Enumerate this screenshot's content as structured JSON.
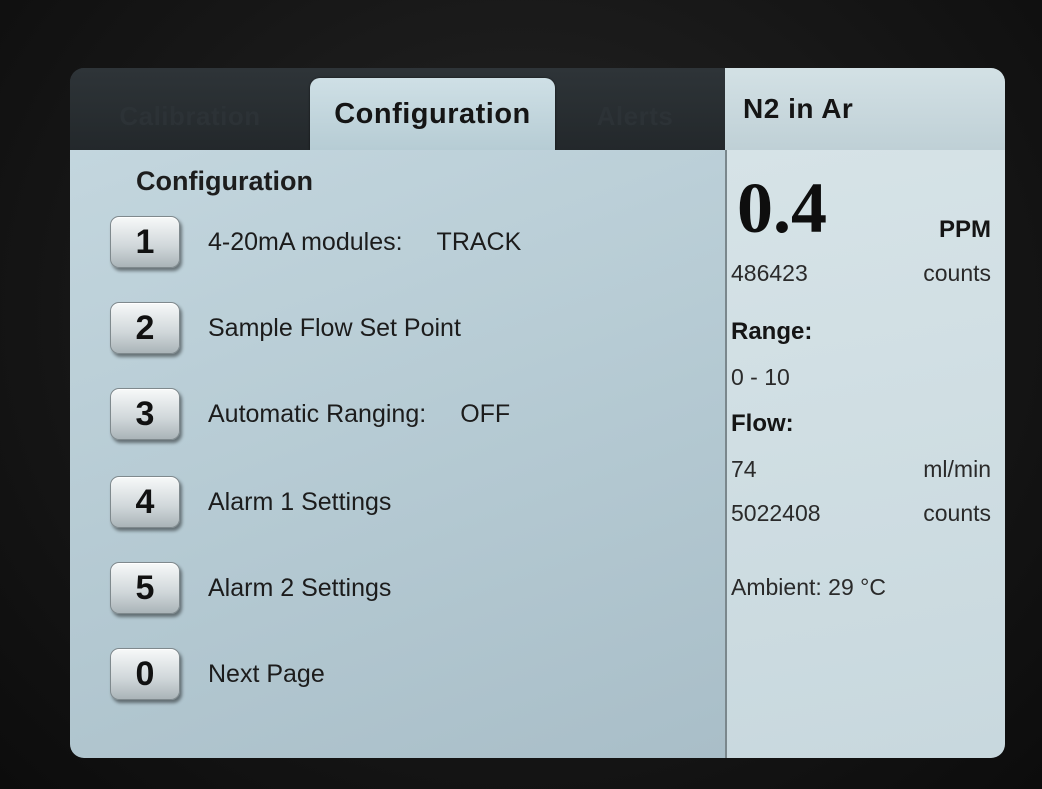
{
  "tabs": {
    "calibration": "Calibration",
    "configuration": "Configuration",
    "alerts": "Alerts",
    "status": "N2 in Ar"
  },
  "panel": {
    "title": "Configuration",
    "items": [
      {
        "key": "1",
        "label": "4-20mA modules:",
        "value": "TRACK"
      },
      {
        "key": "2",
        "label": "Sample Flow Set Point",
        "value": ""
      },
      {
        "key": "3",
        "label": "Automatic Ranging:",
        "value": "OFF"
      },
      {
        "key": "4",
        "label": "Alarm 1 Settings",
        "value": ""
      },
      {
        "key": "5",
        "label": "Alarm 2 Settings",
        "value": ""
      },
      {
        "key": "0",
        "label": "Next Page",
        "value": ""
      }
    ]
  },
  "status": {
    "reading": "0.4",
    "reading_unit": "PPM",
    "reading_counts": "486423",
    "counts_label": "counts",
    "range_label": "Range:",
    "range_value": "0 - 10",
    "flow_label": "Flow:",
    "flow_value": "74",
    "flow_unit": "ml/min",
    "flow_counts": "5022408",
    "flow_counts_label": "counts",
    "ambient": "Ambient: 29 °C"
  }
}
